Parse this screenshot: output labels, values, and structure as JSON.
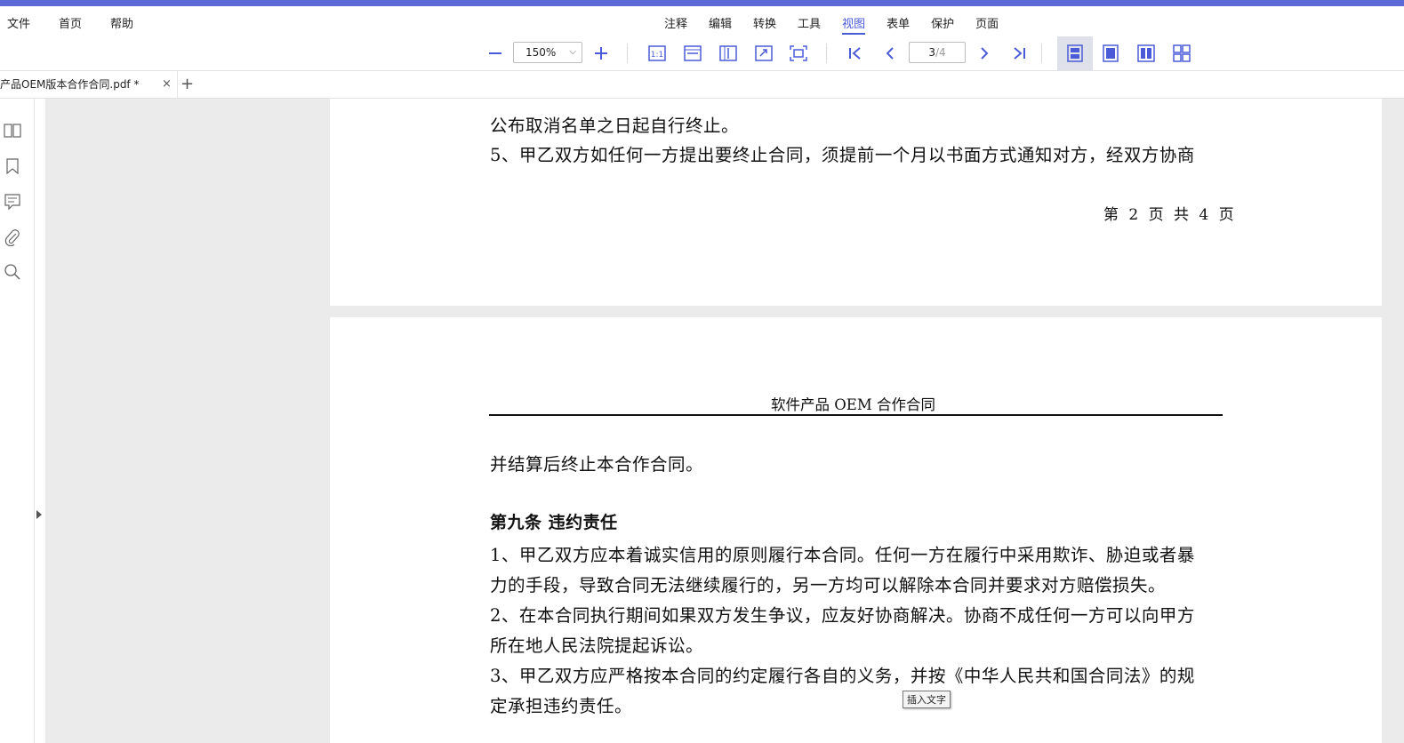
{
  "menu": {
    "left": [
      "文件",
      "首页",
      "帮助"
    ],
    "center": [
      "注释",
      "编辑",
      "转换",
      "工具",
      "视图",
      "表单",
      "保护",
      "页面"
    ],
    "active": "视图"
  },
  "toolbar": {
    "zoom_value": "150%",
    "page_current": "3",
    "page_total": "/4"
  },
  "tabs": {
    "doc_name": "产品OEM版本合作合同.pdf *",
    "close": "×",
    "add": "+"
  },
  "page1": {
    "line1": "公布取消名单之日起自行终止。",
    "line2": "5、甲乙双方如任何一方提出要终止合同，须提前一个月以书面方式通知对方，经双方协商",
    "footer": "第 2 页 共 4 页"
  },
  "page2": {
    "header": "软件产品 OEM 合作合同",
    "line1": "并结算后终止本合作合同。",
    "article_title": "第九条 违约责任",
    "lines": [
      "1、甲乙双方应本着诚实信用的原则履行本合同。任何一方在履行中采用欺诈、胁迫或者暴",
      "力的手段，导致合同无法继续履行的，另一方均可以解除本合同并要求对方赔偿损失。",
      "2、在本合同执行期间如果双方发生争议，应友好协商解决。协商不成任何一方可以向甲方",
      "所在地人民法院提起诉讼。",
      "3、甲乙双方应严格按本合同的约定履行各自的义务，并按《中华人民共和国合同法》的规",
      "定承担违约责任。"
    ]
  },
  "tooltip": "插入文字",
  "colors": {
    "accent": "#4b5bd7",
    "topbar": "#5b6ad6",
    "canvas": "#ebebeb"
  }
}
